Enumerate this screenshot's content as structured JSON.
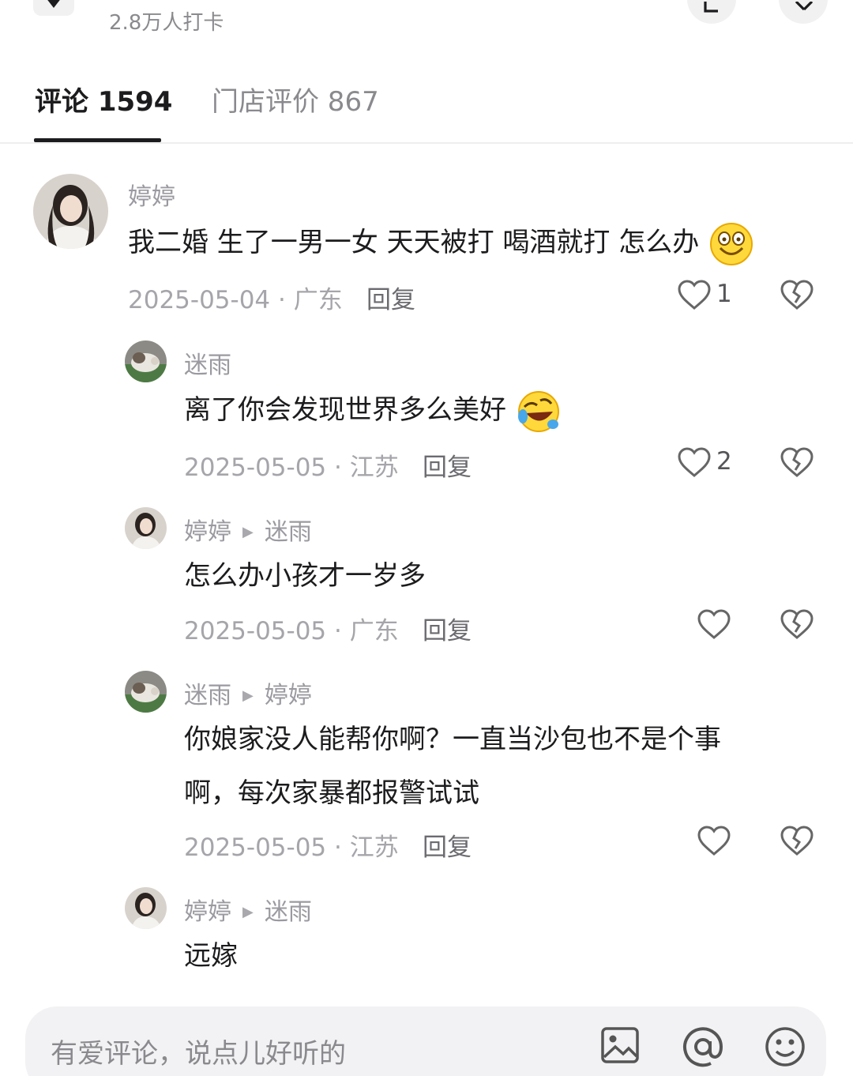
{
  "header": {
    "checkin_text": "2.8万人打卡"
  },
  "tabs": [
    {
      "label": "评论 1594",
      "active": true
    },
    {
      "label": "门店评价 867",
      "active": false
    }
  ],
  "comments": [
    {
      "author": "婷婷",
      "reply_to": "",
      "text": "我二婚 生了一男一女 天天被打 喝酒就打 怎么办",
      "emoji": "grinning-face-emoji",
      "date_location": "2025-05-04 · 广东",
      "reply_label": "回复",
      "likes": "1"
    },
    {
      "author": "迷雨",
      "reply_to": "",
      "text": "离了你会发现世界多么美好",
      "emoji": "rolling-laughing-emoji",
      "date_location": "2025-05-05 · 江苏",
      "reply_label": "回复",
      "likes": "2"
    },
    {
      "author": "婷婷",
      "reply_to": "迷雨",
      "text": "怎么办小孩才一岁多",
      "date_location": "2025-05-05 · 广东",
      "reply_label": "回复",
      "likes": ""
    },
    {
      "author": "迷雨",
      "reply_to": "婷婷",
      "text_line1": "你娘家没人能帮你啊？一直当沙包也不是个事",
      "text_line2": "啊，每次家暴都报警试试",
      "date_location": "2025-05-05 · 江苏",
      "reply_label": "回复",
      "likes": ""
    },
    {
      "author": "婷婷",
      "reply_to": "迷雨",
      "text": "远嫁"
    }
  ],
  "input_bar": {
    "placeholder": "有爱评论，说点儿好听的",
    "icons": [
      "image-icon",
      "at-icon",
      "emoji-icon"
    ]
  },
  "colors": {
    "text": "#1c1c1e",
    "muted": "#9a9aa0",
    "accent_underline": "#1c1c1e",
    "input_bg": "#f2f2f4"
  }
}
